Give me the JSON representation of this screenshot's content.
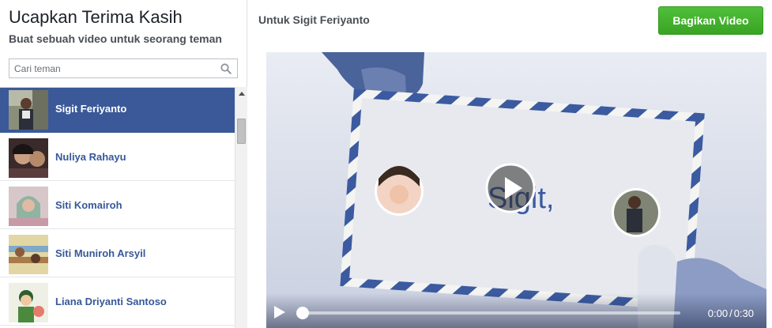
{
  "left_panel": {
    "title": "Ucapkan Terima Kasih",
    "subtitle": "Buat sebuah video untuk seorang teman",
    "search": {
      "placeholder": "Cari teman",
      "value": "",
      "icon": "search-icon"
    },
    "friends": [
      {
        "name": "Sigit Feriyanto",
        "selected": true
      },
      {
        "name": "Nuliya Rahayu",
        "selected": false
      },
      {
        "name": "Siti Komairoh",
        "selected": false
      },
      {
        "name": "Siti Muniroh Arsyil",
        "selected": false
      },
      {
        "name": "Liana Driyanti Santoso",
        "selected": false
      }
    ]
  },
  "header": {
    "recipient_label": "Untuk Sigit Feriyanto",
    "share_button": "Bagikan Video"
  },
  "video": {
    "overlay_text": "Sigit,",
    "current_time": "0:00",
    "duration": "0:30",
    "time_separator": "/",
    "progress": 0
  },
  "colors": {
    "selected_row": "#3b5998",
    "link_blue": "#365899",
    "share_green": "#42b72a",
    "envelope_stripe_blue": "#3b5aa0"
  }
}
